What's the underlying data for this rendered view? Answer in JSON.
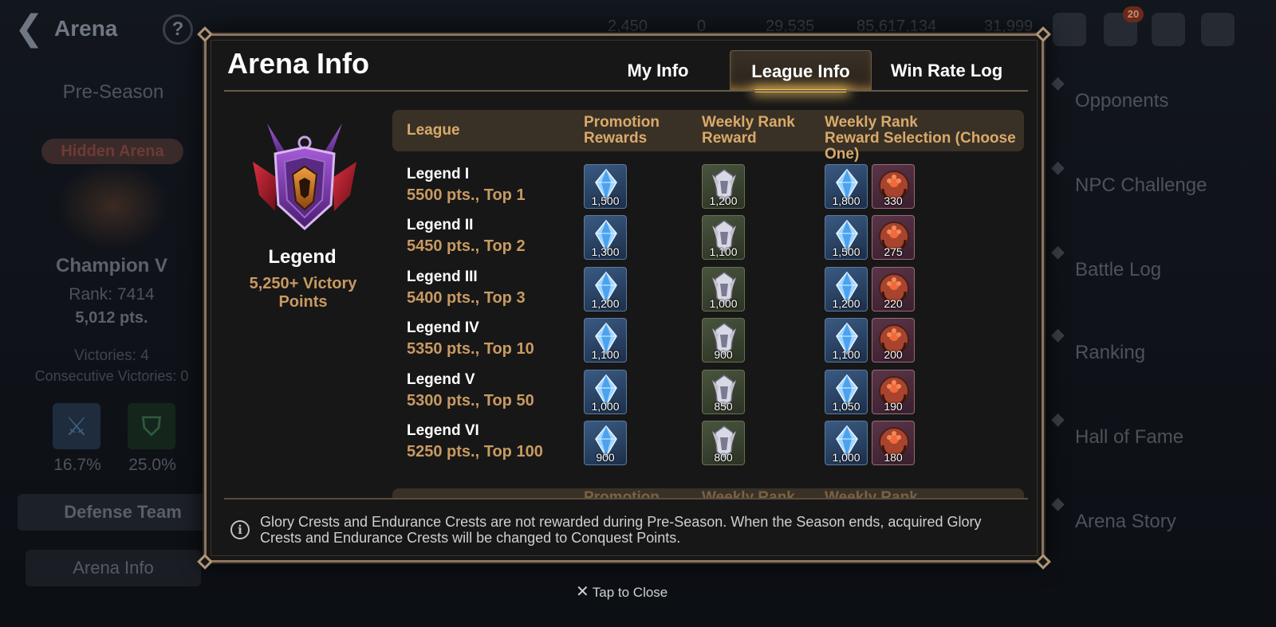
{
  "screen": {
    "back_icon": "chevron-left-icon",
    "title": "Arena",
    "help": "?",
    "resources": [
      "2,450",
      "0",
      "29,535",
      "85,617,134",
      "31,999"
    ],
    "notification_count": "20"
  },
  "left_panel": {
    "season": "Pre-Season",
    "hidden_arena": "Hidden Arena",
    "rank_name": "Champion V",
    "rank": "Rank: 7414",
    "points": "5,012 pts.",
    "victories": "Victories: 4",
    "consecutive": "Consecutive Victories: 0",
    "attack_pct": "16.7%",
    "defense_pct": "25.0%",
    "defense_team": "Defense Team",
    "arena_info": "Arena Info"
  },
  "right_menu": [
    {
      "label": "Opponents"
    },
    {
      "label": "NPC Challenge"
    },
    {
      "label": "Battle Log"
    },
    {
      "label": "Ranking"
    },
    {
      "label": "Hall of Fame"
    },
    {
      "label": "Arena Story"
    }
  ],
  "modal": {
    "title": "Arena Info",
    "tabs": [
      {
        "label": "My Info",
        "active": false
      },
      {
        "label": "League Info",
        "active": true
      },
      {
        "label": "Win Rate Log",
        "active": false
      }
    ],
    "league": {
      "name": "Legend",
      "requirement": "5,250+ Victory Points"
    },
    "table_headers": {
      "league": "League",
      "promotion_1": "Promotion",
      "promotion_2": "Rewards",
      "weekly_1": "Weekly Rank",
      "weekly_2": "Reward",
      "selection_1": "Weekly Rank",
      "selection_2": "Reward Selection (Choose One)"
    },
    "rows": [
      {
        "name": "Legend I",
        "req": "5500 pts., Top 1",
        "promotion": "1,500",
        "weekly": "1,200",
        "sel_gem": "1,800",
        "sel_endurance": "330"
      },
      {
        "name": "Legend II",
        "req": "5450 pts., Top 2",
        "promotion": "1,300",
        "weekly": "1,100",
        "sel_gem": "1,500",
        "sel_endurance": "275"
      },
      {
        "name": "Legend III",
        "req": "5400 pts., Top 3",
        "promotion": "1,200",
        "weekly": "1,000",
        "sel_gem": "1,200",
        "sel_endurance": "220"
      },
      {
        "name": "Legend IV",
        "req": "5350 pts., Top 10",
        "promotion": "1,100",
        "weekly": "900",
        "sel_gem": "1,100",
        "sel_endurance": "200"
      },
      {
        "name": "Legend V",
        "req": "5300 pts., Top 50",
        "promotion": "1,000",
        "weekly": "850",
        "sel_gem": "1,050",
        "sel_endurance": "190"
      },
      {
        "name": "Legend VI",
        "req": "5250 pts., Top 100",
        "promotion": "900",
        "weekly": "800",
        "sel_gem": "1,000",
        "sel_endurance": "180"
      }
    ],
    "footer_note": "Glory Crests and Endurance Crests are not rewarded during Pre-Season. When the Season ends, acquired Glory Crests and Endurance Crests will be changed to Conquest Points."
  },
  "tap_to_close": "Tap to Close",
  "colors": {
    "accent_gold": "#c89a61",
    "header_gold": "#d9aa6a",
    "tab_glow": "#f4c35c",
    "modal_border": "#8a7560"
  },
  "icons": {
    "gem": "skystone-gem-icon",
    "crest": "glory-crest-icon",
    "endurance": "endurance-crest-icon",
    "info": "info-icon",
    "close": "close-icon"
  }
}
